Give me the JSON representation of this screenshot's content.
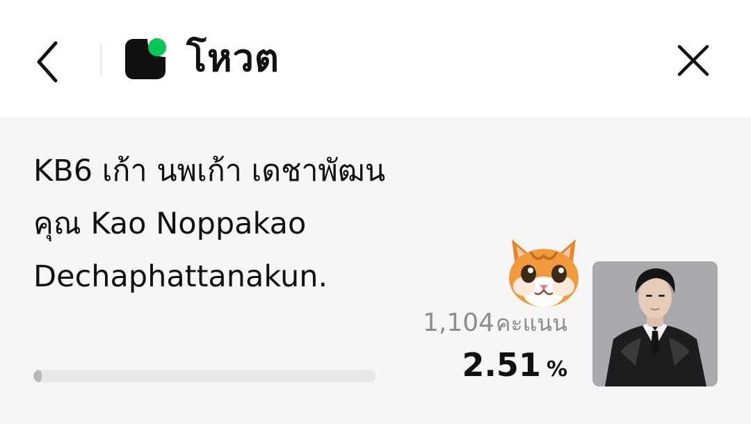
{
  "header": {
    "back_icon": "chevron-left-icon",
    "logo_icon": "line-voom-logo-icon",
    "title": "โหวต",
    "close_icon": "close-icon",
    "colors": {
      "logo_dark": "#111111",
      "logo_accent": "#06c755"
    }
  },
  "vote_item": {
    "candidate_name": "KB6 เก้า นพเก้า เดชาพัฒนคุณ Kao Noppakao Dechaphattanakun.",
    "votes": "1,104",
    "votes_unit": "คะแนน",
    "percentage": "2.51",
    "percent_sign": "%",
    "progress_fraction": 0.0251,
    "sticker_icon": "orange-cat-face-icon",
    "photo": "candidate-portrait",
    "colors": {
      "card_background": "#f6f6f6",
      "progress_track": "#e8e8e8",
      "progress_fill": "#b9b9b9"
    }
  }
}
